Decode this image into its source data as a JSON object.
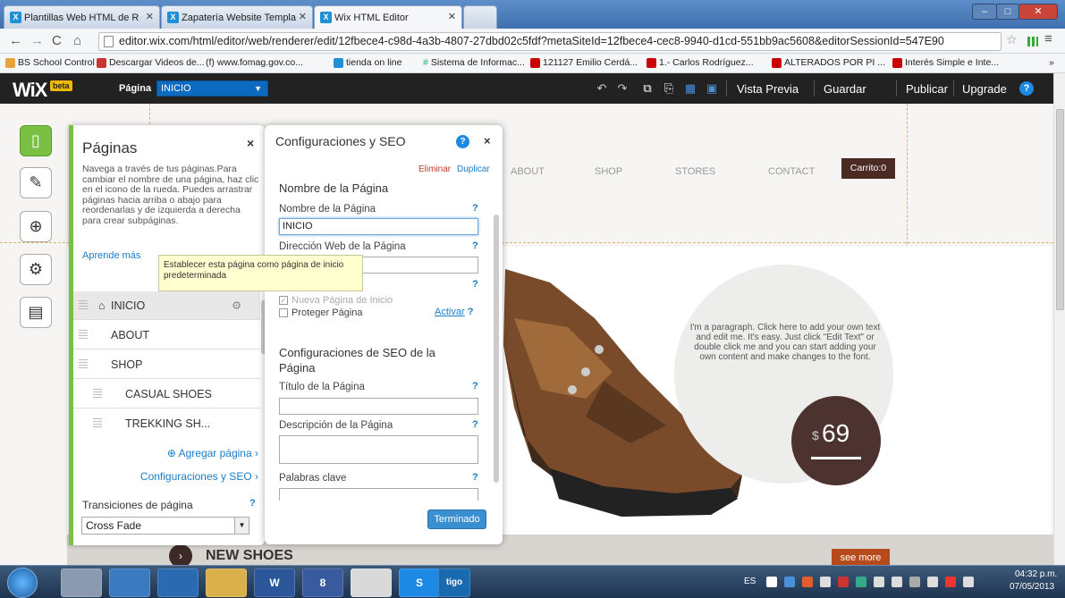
{
  "browser": {
    "tabs": [
      {
        "label": "Plantillas Web HTML de R",
        "active": false
      },
      {
        "label": "Zapatería Website Templa",
        "active": false
      },
      {
        "label": "Wix HTML Editor",
        "active": true
      }
    ],
    "url": "editor.wix.com/html/editor/web/renderer/edit/12fbece4-c98d-4a3b-4807-27dbd02c5fdf?metaSiteId=12fbece4-cec8-9940-d1cd-551bb9ac5608&editorSessionId=547E90",
    "bookmarks": [
      "BS School Control",
      "Descargar Videos de...",
      "www.fomag.gov.co...",
      "tienda on line",
      "Sistema de Informac...",
      "121127 Emilio Cerdá...",
      "1.- Carlos Rodríguez...",
      "ALTERADOS POR PI ...",
      "Interés Simple e Inte..."
    ],
    "bookmarks_more": "»"
  },
  "wix_bar": {
    "logo": "WiX",
    "beta": "beta",
    "page_label": "Página",
    "page_value": "INICIO",
    "preview": "Vista Previa",
    "save": "Guardar",
    "publish": "Publicar",
    "upgrade": "Upgrade",
    "help": "?"
  },
  "site": {
    "nav": [
      "ABOUT",
      "SHOP",
      "STORES",
      "CONTACT"
    ],
    "cart": "Carrito:0",
    "paragraph": "I'm a paragraph. Click here to add your own text and edit me. It's easy. Just click \"Edit Text\" or double click me and you can start adding your own content and make changes to the font.",
    "price_currency": "$",
    "price_value": "69",
    "section_title": "NEW SHOES",
    "see_more": "see more"
  },
  "pages_panel": {
    "title": "Páginas",
    "close": "×",
    "description": "Navega a través de tus páginas.Para cambiar el nombre de una página, haz clic en el icono de la rueda. Puedes arrastrar páginas hacia arriba o abajo para reordenarlas y de izquierda a derecha para crear subpáginas.",
    "learn_more": "Aprende más",
    "pages": [
      {
        "label": "INICIO",
        "home": true,
        "selected": true,
        "sub": false
      },
      {
        "label": "ABOUT",
        "home": false,
        "selected": false,
        "sub": false
      },
      {
        "label": "SHOP",
        "home": false,
        "selected": false,
        "sub": false
      },
      {
        "label": "CASUAL SHOES",
        "home": false,
        "selected": false,
        "sub": true
      },
      {
        "label": "TREKKING SH...",
        "home": false,
        "selected": false,
        "sub": true
      }
    ],
    "add_page": "Agregar página",
    "seo_link": "Configuraciones y SEO",
    "transitions_label": "Transiciones de página",
    "transitions_help": "?",
    "transitions_value": "Cross Fade"
  },
  "tooltip": "Establecer esta página como página de inicio predeterminada",
  "seo_panel": {
    "title": "Configuraciones y SEO",
    "help": "?",
    "close": "×",
    "delete": "Eliminar",
    "duplicate": "Duplicar",
    "section_name": "Nombre de la Página",
    "name_label": "Nombre de la Página",
    "name_value": "INICIO",
    "url_label": "Dirección Web de la Página",
    "url_value": "",
    "home_checkbox": "Nueva Página de Inicio",
    "protect_checkbox": "Proteger Página",
    "activate": "Activar",
    "section_seo": "Configuraciones de SEO de la Página",
    "title_label": "Título de la Página",
    "description_label": "Descripción de la Página",
    "keywords_label": "Palabras clave",
    "done": "Terminado",
    "help_mark": "?"
  },
  "taskbar": {
    "apps": [
      "",
      "",
      "",
      "",
      "W",
      "8",
      "",
      "S",
      "tigo"
    ],
    "lang": "ES",
    "time": "04:32 p.m.",
    "date": "07/05/2013"
  },
  "colors": {
    "accent_green": "#7ac143",
    "wix_bar": "#222222",
    "link_blue": "#1a7dc8",
    "cart_brown": "#4a2a22",
    "see_more_orange": "#b74a1b"
  }
}
